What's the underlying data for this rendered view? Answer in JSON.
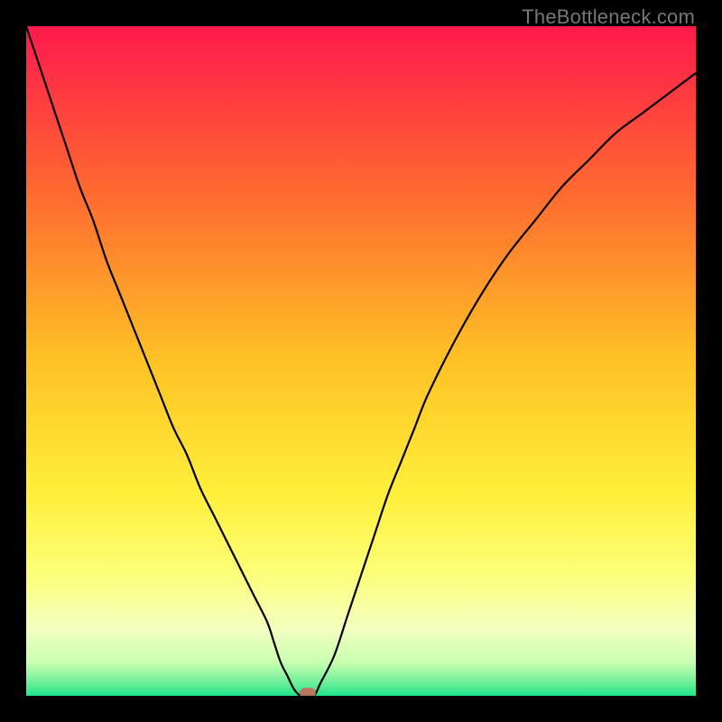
{
  "watermark": {
    "text": "TheBottleneck.com"
  },
  "chart_data": {
    "type": "line",
    "title": "",
    "xlabel": "",
    "ylabel": "",
    "xlim": [
      0,
      100
    ],
    "ylim": [
      0,
      100
    ],
    "x": [
      0,
      2,
      4,
      6,
      8,
      10,
      12,
      14,
      16,
      18,
      20,
      22,
      24,
      26,
      28,
      30,
      32,
      34,
      36,
      37,
      38,
      39,
      40,
      41,
      42,
      43,
      44,
      46,
      48,
      50,
      52,
      54,
      56,
      58,
      60,
      64,
      68,
      72,
      76,
      80,
      84,
      88,
      92,
      96,
      100
    ],
    "values": [
      100,
      94,
      88,
      82,
      76,
      71,
      65,
      60,
      55,
      50,
      45,
      40,
      36,
      31,
      27,
      23,
      19,
      15,
      11,
      8,
      5,
      3,
      1,
      0,
      0,
      0,
      2,
      6,
      12,
      18,
      24,
      30,
      35,
      40,
      45,
      53,
      60,
      66,
      71,
      76,
      80,
      84,
      87,
      90,
      93
    ],
    "marker": {
      "x": 42,
      "y": 0,
      "color": "#c86a5a"
    },
    "gradient_stops": [
      {
        "offset": 0,
        "color": "#ff194d"
      },
      {
        "offset": 25,
        "color": "#ff6a30"
      },
      {
        "offset": 50,
        "color": "#ffc225"
      },
      {
        "offset": 70,
        "color": "#ffef3a"
      },
      {
        "offset": 82,
        "color": "#fcff7a"
      },
      {
        "offset": 90,
        "color": "#f3ffc0"
      },
      {
        "offset": 95,
        "color": "#c9ffb0"
      },
      {
        "offset": 98,
        "color": "#6fef9a"
      },
      {
        "offset": 100,
        "color": "#1de58a"
      }
    ]
  }
}
